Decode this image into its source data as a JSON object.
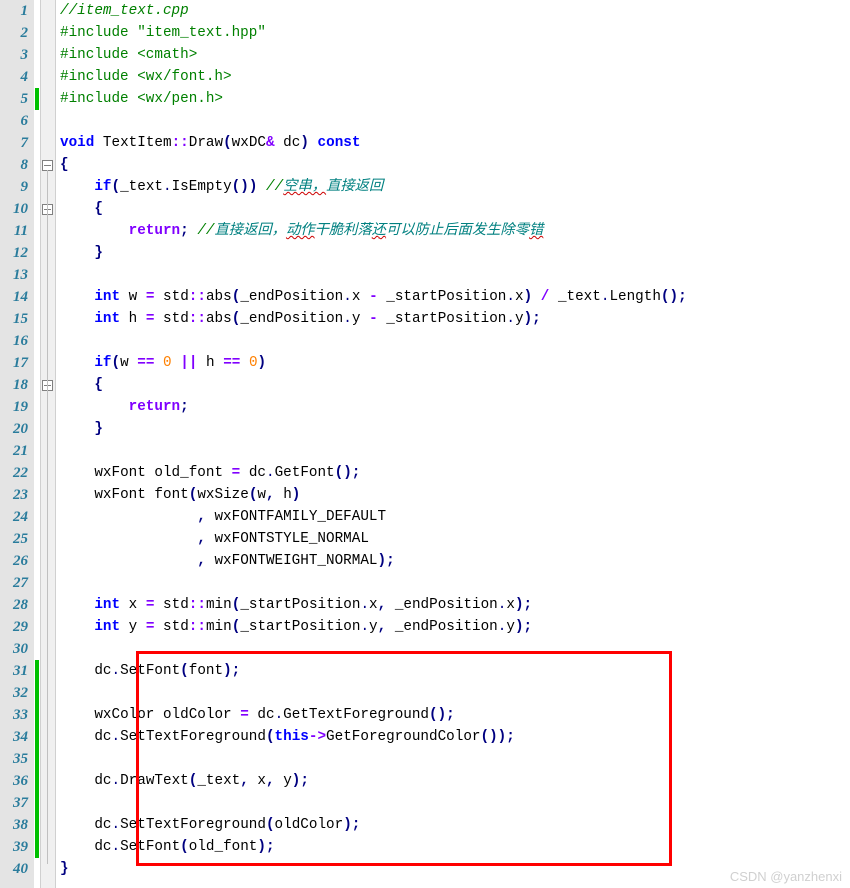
{
  "watermark": "CSDN @yanzhenxi",
  "lines": [
    {
      "n": 1,
      "html": "<span class='c-comment'>//item_text.cpp</span>"
    },
    {
      "n": 2,
      "html": "<span class='c-preproc'>#include \"item_text.hpp\"</span>"
    },
    {
      "n": 3,
      "html": "<span class='c-preproc'>#include &lt;cmath&gt;</span>"
    },
    {
      "n": 4,
      "html": "<span class='c-preproc'>#include &lt;wx/font.h&gt;</span>"
    },
    {
      "n": 5,
      "html": "<span class='c-preproc'>#include &lt;wx/pen.h&gt;</span>",
      "changed": true
    },
    {
      "n": 6,
      "html": ""
    },
    {
      "n": 7,
      "html": "<span class='c-keyword'>void</span> <span class='c-ident'>TextItem</span><span class='c-op'>::</span><span class='c-func'>Draw</span><span class='c-op2'>(</span><span class='c-ident'>wxDC</span><span class='c-op'>&amp;</span> <span class='c-ident'>dc</span><span class='c-op2'>)</span> <span class='c-keyword'>const</span>"
    },
    {
      "n": 8,
      "html": "<span class='c-brace'>{</span>",
      "fold": true
    },
    {
      "n": 9,
      "html": "    <span class='c-keyword'>if</span><span class='c-op2'>(</span><span class='c-ident'>_text</span><span class='c-dot'>.</span><span class='c-func'>IsEmpty</span><span class='c-op2'>())</span> <span class='c-comment'>//</span><span class='c-comment-cn c-wavy'>空串，</span><span class='c-comment-cn'>直接返回</span>"
    },
    {
      "n": 10,
      "html": "    <span class='c-brace'>{</span>",
      "fold": true
    },
    {
      "n": 11,
      "html": "        <span class='c-keyword2'>return</span><span class='c-op2'>;</span> <span class='c-comment'>//</span><span class='c-comment-cn'>直接返回，<span class='c-wavy'>动作</span>干脆利落<span class='c-wavy'>还</span>可以防止后面发生除零<span class='c-wavy'>错</span></span>"
    },
    {
      "n": 12,
      "html": "    <span class='c-brace'>}</span>"
    },
    {
      "n": 13,
      "html": ""
    },
    {
      "n": 14,
      "html": "    <span class='c-keyword'>int</span> <span class='c-ident'>w</span> <span class='c-op'>=</span> <span class='c-ident'>std</span><span class='c-op'>::</span><span class='c-func'>abs</span><span class='c-op2'>(</span><span class='c-ident'>_endPosition</span><span class='c-dot'>.</span><span class='c-ident'>x</span> <span class='c-op'>-</span> <span class='c-ident'>_startPosition</span><span class='c-dot'>.</span><span class='c-ident'>x</span><span class='c-op2'>)</span> <span class='c-op'>/</span> <span class='c-ident'>_text</span><span class='c-dot'>.</span><span class='c-func'>Length</span><span class='c-op2'>();</span>"
    },
    {
      "n": 15,
      "html": "    <span class='c-keyword'>int</span> <span class='c-ident'>h</span> <span class='c-op'>=</span> <span class='c-ident'>std</span><span class='c-op'>::</span><span class='c-func'>abs</span><span class='c-op2'>(</span><span class='c-ident'>_endPosition</span><span class='c-dot'>.</span><span class='c-ident'>y</span> <span class='c-op'>-</span> <span class='c-ident'>_startPosition</span><span class='c-dot'>.</span><span class='c-ident'>y</span><span class='c-op2'>);</span>"
    },
    {
      "n": 16,
      "html": ""
    },
    {
      "n": 17,
      "html": "    <span class='c-keyword'>if</span><span class='c-op2'>(</span><span class='c-ident'>w</span> <span class='c-op'>==</span> <span class='c-number'>0</span> <span class='c-op'>||</span> <span class='c-ident'>h</span> <span class='c-op'>==</span> <span class='c-number'>0</span><span class='c-op2'>)</span>"
    },
    {
      "n": 18,
      "html": "    <span class='c-brace'>{</span>",
      "fold": true
    },
    {
      "n": 19,
      "html": "        <span class='c-keyword2'>return</span><span class='c-op2'>;</span>"
    },
    {
      "n": 20,
      "html": "    <span class='c-brace'>}</span>"
    },
    {
      "n": 21,
      "html": ""
    },
    {
      "n": 22,
      "html": "    <span class='c-ident'>wxFont old_font</span> <span class='c-op'>=</span> <span class='c-ident'>dc</span><span class='c-dot'>.</span><span class='c-func'>GetFont</span><span class='c-op2'>();</span>"
    },
    {
      "n": 23,
      "html": "    <span class='c-ident'>wxFont</span> <span class='c-func'>font</span><span class='c-op2'>(</span><span class='c-func'>wxSize</span><span class='c-op2'>(</span><span class='c-ident'>w</span><span class='c-op2'>,</span> <span class='c-ident'>h</span><span class='c-op2'>)</span>"
    },
    {
      "n": 24,
      "html": "                <span class='c-op2'>,</span> <span class='c-ident'>wxFONTFAMILY_DEFAULT</span>"
    },
    {
      "n": 25,
      "html": "                <span class='c-op2'>,</span> <span class='c-ident'>wxFONTSTYLE_NORMAL</span>"
    },
    {
      "n": 26,
      "html": "                <span class='c-op2'>,</span> <span class='c-ident'>wxFONTWEIGHT_NORMAL</span><span class='c-op2'>);</span>"
    },
    {
      "n": 27,
      "html": ""
    },
    {
      "n": 28,
      "html": "    <span class='c-keyword'>int</span> <span class='c-ident'>x</span> <span class='c-op'>=</span> <span class='c-ident'>std</span><span class='c-op'>::</span><span class='c-func'>min</span><span class='c-op2'>(</span><span class='c-ident'>_startPosition</span><span class='c-dot'>.</span><span class='c-ident'>x</span><span class='c-op2'>,</span> <span class='c-ident'>_endPosition</span><span class='c-dot'>.</span><span class='c-ident'>x</span><span class='c-op2'>);</span>"
    },
    {
      "n": 29,
      "html": "    <span class='c-keyword'>int</span> <span class='c-ident'>y</span> <span class='c-op'>=</span> <span class='c-ident'>std</span><span class='c-op'>::</span><span class='c-func'>min</span><span class='c-op2'>(</span><span class='c-ident'>_startPosition</span><span class='c-dot'>.</span><span class='c-ident'>y</span><span class='c-op2'>,</span> <span class='c-ident'>_endPosition</span><span class='c-dot'>.</span><span class='c-ident'>y</span><span class='c-op2'>);</span>"
    },
    {
      "n": 30,
      "html": ""
    },
    {
      "n": 31,
      "html": "    <span class='c-ident'>dc</span><span class='c-dot'>.</span><span class='c-func'>SetFont</span><span class='c-op2'>(</span><span class='c-ident'>font</span><span class='c-op2'>);</span>",
      "changed": true
    },
    {
      "n": 32,
      "html": "",
      "changed": true
    },
    {
      "n": 33,
      "html": "    <span class='c-ident'>wxColor oldColor</span> <span class='c-op'>=</span> <span class='c-ident'>dc</span><span class='c-dot'>.</span><span class='c-func'>GetTextForeground</span><span class='c-op2'>();</span>",
      "changed": true
    },
    {
      "n": 34,
      "html": "    <span class='c-ident'>dc</span><span class='c-dot'>.</span><span class='c-func'>SetTextForeground</span><span class='c-op2'>(</span><span class='c-keyword'>this</span><span class='c-op'>-&gt;</span><span class='c-func'>GetForegroundColor</span><span class='c-op2'>());</span>",
      "changed": true
    },
    {
      "n": 35,
      "html": "",
      "changed": true
    },
    {
      "n": 36,
      "html": "    <span class='c-ident'>dc</span><span class='c-dot'>.</span><span class='c-func'>DrawText</span><span class='c-op2'>(</span><span class='c-ident'>_text</span><span class='c-op2'>,</span> <span class='c-ident'>x</span><span class='c-op2'>,</span> <span class='c-ident'>y</span><span class='c-op2'>);</span>",
      "changed": true
    },
    {
      "n": 37,
      "html": "",
      "changed": true
    },
    {
      "n": 38,
      "html": "    <span class='c-ident'>dc</span><span class='c-dot'>.</span><span class='c-func'>SetTextForeground</span><span class='c-op2'>(</span><span class='c-ident'>oldColor</span><span class='c-op2'>);</span>",
      "changed": true
    },
    {
      "n": 39,
      "html": "    <span class='c-ident'>dc</span><span class='c-dot'>.</span><span class='c-func'>SetFont</span><span class='c-op2'>(</span><span class='c-ident'>old_font</span><span class='c-op2'>);</span>",
      "changed": true
    },
    {
      "n": 40,
      "html": "<span class='c-brace'>}</span>"
    }
  ]
}
